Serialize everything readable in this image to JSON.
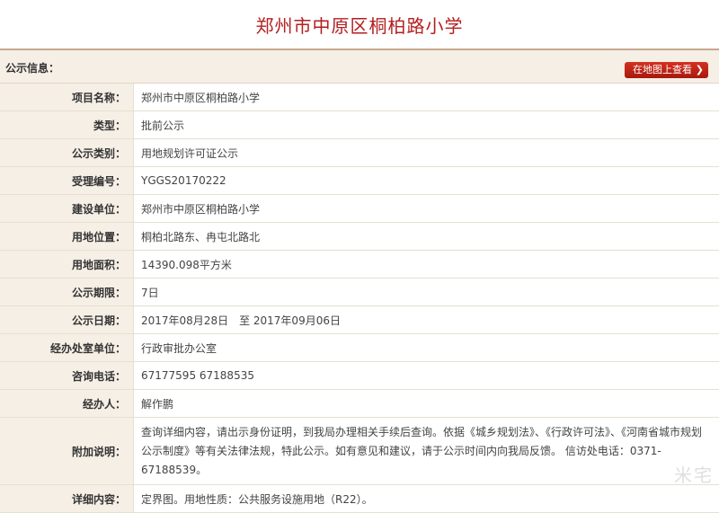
{
  "page_title": "郑州市中原区桐柏路小学",
  "notice_label": "公示信息：",
  "map_button_label": "在地图上查看",
  "rows": [
    {
      "label": "项目名称：",
      "value": "郑州市中原区桐柏路小学"
    },
    {
      "label": "类型：",
      "value": "批前公示"
    },
    {
      "label": "公示类别：",
      "value": "用地规划许可证公示"
    },
    {
      "label": "受理编号：",
      "value": "YGGS20170222"
    },
    {
      "label": "建设单位：",
      "value": "郑州市中原区桐柏路小学"
    },
    {
      "label": "用地位置：",
      "value": "桐柏北路东、冉屯北路北"
    },
    {
      "label": "用地面积：",
      "value": "14390.098平方米"
    },
    {
      "label": "公示期限：",
      "value": "7日"
    },
    {
      "label": "公示日期：",
      "value": "2017年08月28日　至 2017年09月06日"
    },
    {
      "label": "经办处室单位：",
      "value": "行政审批办公室"
    },
    {
      "label": "咨询电话：",
      "value": "67177595 67188535"
    },
    {
      "label": "经办人：",
      "value": "解作鹏"
    },
    {
      "label": "附加说明：",
      "value": "查询详细内容，请出示身份证明，到我局办理相关手续后查询。依据《城乡规划法》、《行政许可法》、《河南省城市规划公示制度》等有关法律法规，特此公示。如有意见和建议，请于公示时间内向我局反馈。 信访处电话：0371-67188539。"
    },
    {
      "label": "详细内容：",
      "value": "定界图。用地性质：公共服务设施用地（R22）。"
    }
  ],
  "watermark": "米宅",
  "colors": {
    "title": "#b31f1f",
    "label_bg": "#f5efe6",
    "button": "#c42518"
  },
  "icons": {
    "map_button_arrow": "chevron-right-icon"
  }
}
